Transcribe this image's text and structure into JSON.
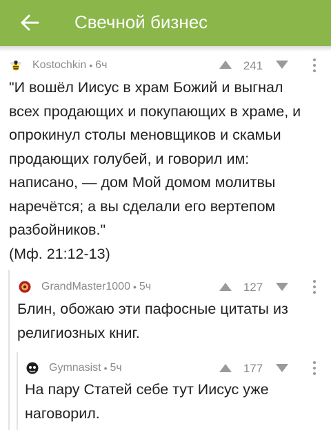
{
  "header": {
    "title": "Свечной бизнес",
    "background": "#8ab64a"
  },
  "comments": [
    {
      "author": "Kostochkin",
      "time": "6ч",
      "rating": "241",
      "avatar_icon": "bee-avatar-icon",
      "text": "\"И вошёл Иисус в храм Божий и выгнал\nвсех продающих и покупающих в храме, и\nопрокинул столы меновщиков и скамьи\nпродающих голубей, и говорил им:\nнаписано, — дом Мой домом молитвы\nнаречётся; а вы сделали его вертепом\nразбойников.\"\n(Мф. 21:12-13)"
    },
    {
      "author": "GrandMaster1000",
      "time": "5ч",
      "rating": "127",
      "avatar_icon": "red-emblem-avatar-icon",
      "text": "Блин, обожаю эти пафосные цитаты из\nрелигиозных книг."
    },
    {
      "author": "Gymnasist",
      "time": "5ч",
      "rating": "177",
      "avatar_icon": "dark-face-avatar-icon",
      "text": "На пару Статей себе тут Иисус уже\nнаговорил."
    }
  ],
  "separator": "•",
  "colors": {
    "meta_text": "#8b8b8b",
    "body_text": "#222222",
    "thread_line": "#e2e2e2"
  }
}
